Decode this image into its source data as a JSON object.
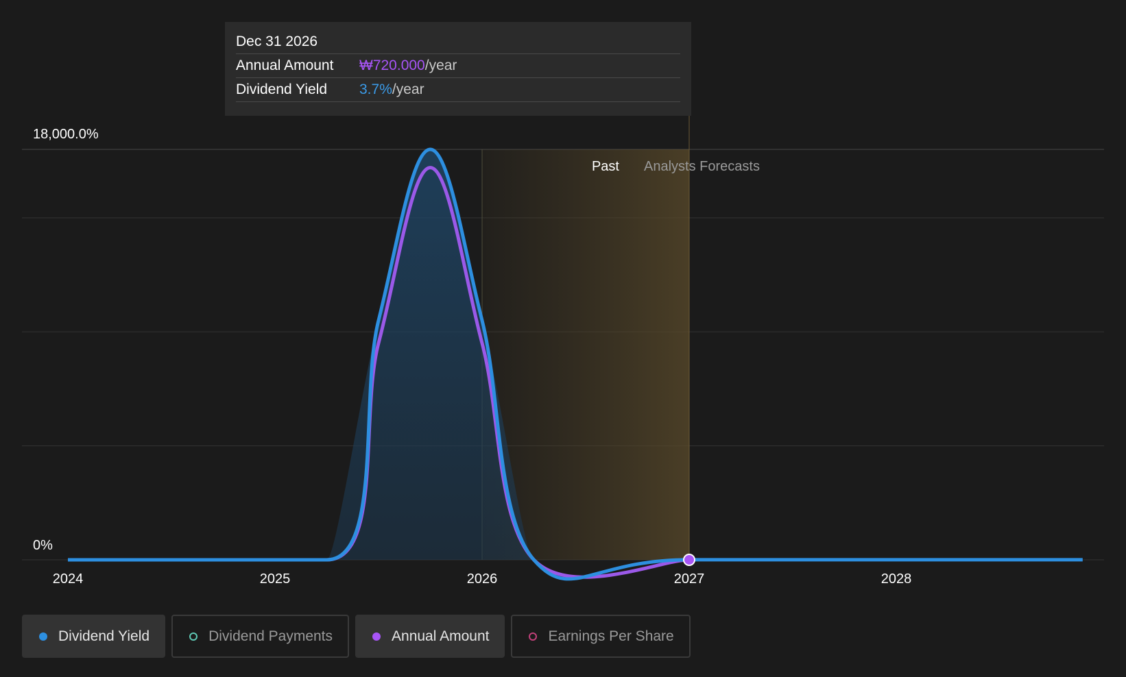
{
  "tooltip": {
    "date": "Dec 31 2026",
    "rows": [
      {
        "label": "Annual Amount",
        "value": "₩720.000",
        "unit": "/year"
      },
      {
        "label": "Dividend Yield",
        "value": "3.7%",
        "unit": "/year"
      }
    ]
  },
  "chart_data": {
    "type": "area",
    "y_tick_labels": [
      "18,000.0%",
      "0%"
    ],
    "ylim": [
      0,
      18000
    ],
    "x_tick_labels": [
      "2024",
      "2025",
      "2026",
      "2027",
      "2028"
    ],
    "xlim": [
      2024.0,
      2028.9
    ],
    "regions": {
      "past_label": "Past",
      "forecast_label": "Analysts Forecasts"
    },
    "series": [
      {
        "name": "Dividend Yield",
        "color": "#2d8fe0",
        "x": [
          2024.0,
          2025.25,
          2025.5,
          2025.75,
          2026.0,
          2026.25,
          2027.0,
          2028.9
        ],
        "y": [
          0,
          0,
          10500,
          18000,
          10500,
          0,
          3.7,
          3.7
        ]
      },
      {
        "name": "Annual Amount",
        "color": "#a855f7",
        "x": [
          2024.0,
          2025.25,
          2025.5,
          2025.75,
          2026.0,
          2026.25,
          2027.0
        ],
        "y": [
          0,
          0,
          9500,
          17200,
          9500,
          0,
          3.7
        ]
      }
    ],
    "highlight": {
      "x": 2027.0,
      "label": "Dec 31 2026"
    },
    "grid": true
  },
  "legend": [
    {
      "label": "Dividend Yield",
      "active": true,
      "marker": "filled-blue"
    },
    {
      "label": "Dividend Payments",
      "active": false,
      "marker": "ring-teal"
    },
    {
      "label": "Annual Amount",
      "active": true,
      "marker": "filled-purple"
    },
    {
      "label": "Earnings Per Share",
      "active": false,
      "marker": "ring-pink"
    }
  ]
}
